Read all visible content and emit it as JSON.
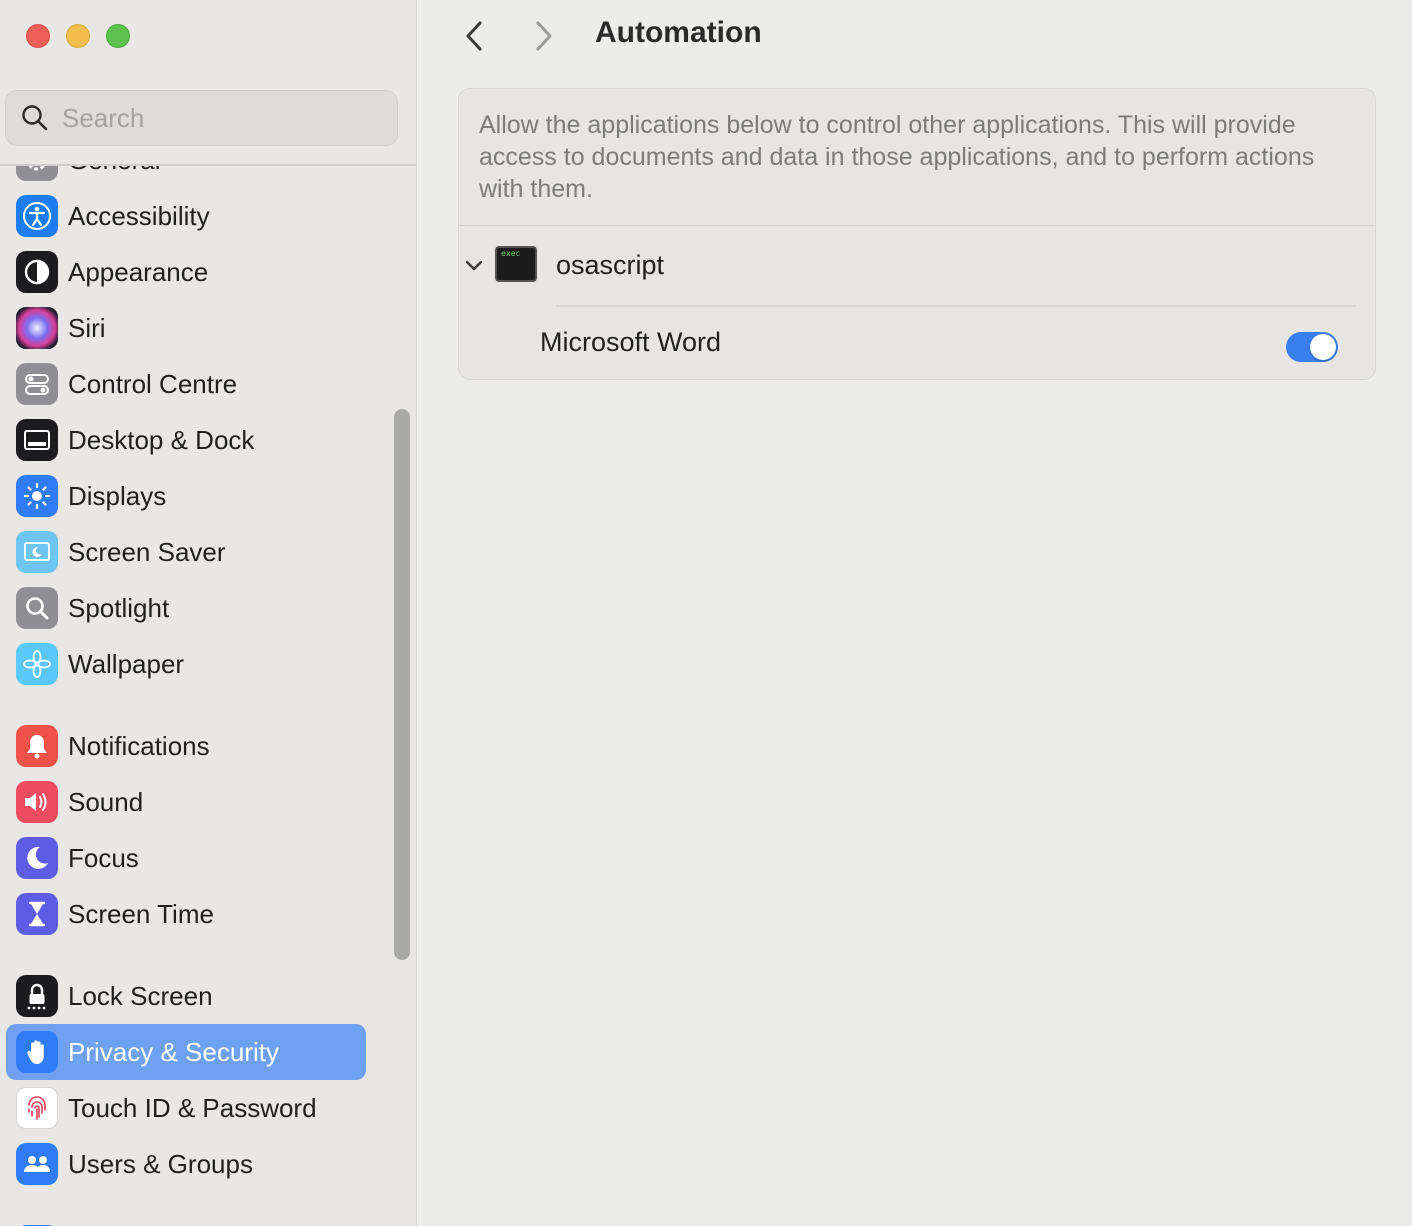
{
  "window": {
    "traffic_lights": {
      "close": "#ee5f57",
      "minimize": "#f4be4f",
      "zoom": "#5ec24f"
    }
  },
  "sidebar": {
    "search": {
      "placeholder": "Search",
      "value": ""
    },
    "items": [
      {
        "label": "General",
        "icon": "gear-icon",
        "color": "#8e8e93"
      },
      {
        "label": "Accessibility",
        "icon": "accessibility-icon",
        "color": "#1e7cf2"
      },
      {
        "label": "Appearance",
        "icon": "appearance-icon",
        "color": "#1c1c1e"
      },
      {
        "label": "Siri",
        "icon": "siri-icon",
        "color": "#3a3a6a"
      },
      {
        "label": "Control Centre",
        "icon": "control-centre-icon",
        "color": "#8e8e93"
      },
      {
        "label": "Desktop & Dock",
        "icon": "dock-icon",
        "color": "#1c1c1e"
      },
      {
        "label": "Displays",
        "icon": "sun-icon",
        "color": "#2f7cf6"
      },
      {
        "label": "Screen Saver",
        "icon": "screen-saver-icon",
        "color": "#6ec5f0"
      },
      {
        "label": "Spotlight",
        "icon": "spotlight-icon",
        "color": "#8e8e93"
      },
      {
        "label": "Wallpaper",
        "icon": "wallpaper-icon",
        "color": "#5ac8fa"
      },
      {
        "label": "Notifications",
        "icon": "bell-icon",
        "color": "#f0524a"
      },
      {
        "label": "Sound",
        "icon": "speaker-icon",
        "color": "#ef4c5f"
      },
      {
        "label": "Focus",
        "icon": "moon-icon",
        "color": "#5e5ce6"
      },
      {
        "label": "Screen Time",
        "icon": "hourglass-icon",
        "color": "#5e5ce6"
      },
      {
        "label": "Lock Screen",
        "icon": "lock-icon",
        "color": "#1c1c1e"
      },
      {
        "label": "Privacy & Security",
        "icon": "hand-icon",
        "color": "#2f7cf6",
        "selected": true
      },
      {
        "label": "Touch ID & Password",
        "icon": "fingerprint-icon",
        "color": "#ffffff"
      },
      {
        "label": "Users & Groups",
        "icon": "users-icon",
        "color": "#2f7cf6"
      }
    ]
  },
  "toolbar": {
    "title": "Automation"
  },
  "content": {
    "description": "Allow the applications below to control other applications. This will provide access to documents and data in those applications, and to perform actions with them.",
    "app": {
      "name": "osascript",
      "icon_label": "exec",
      "expanded": true,
      "targets": [
        {
          "name": "Microsoft Word",
          "enabled": true
        }
      ]
    }
  },
  "accent": "#3a7ff0"
}
